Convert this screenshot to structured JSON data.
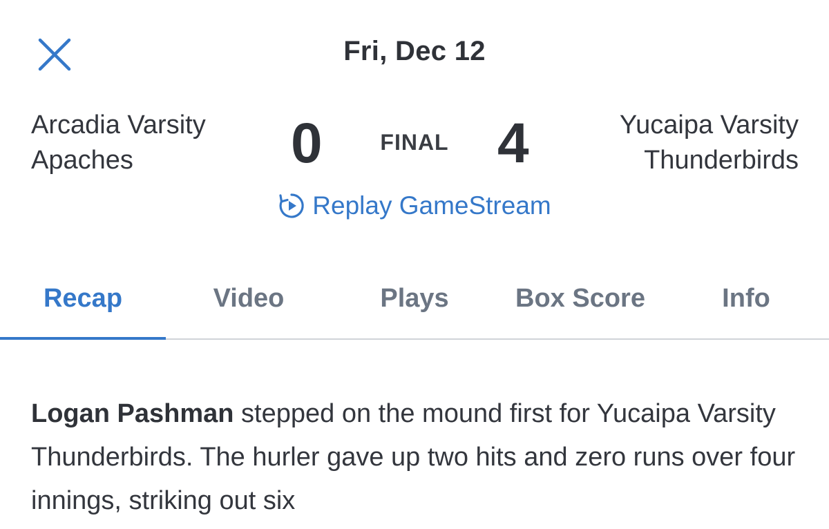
{
  "header": {
    "close_icon": "close-icon",
    "date": "Fri, Dec 12"
  },
  "game": {
    "home_team_line1": "Arcadia Varsity",
    "home_team_line2": "Apaches",
    "home_score": "0",
    "status": "FINAL",
    "away_score": "4",
    "away_team_line1": "Yucaipa Varsity",
    "away_team_line2": "Thunderbirds"
  },
  "replay": {
    "icon": "replay-icon",
    "label": "Replay GameStream"
  },
  "tabs": [
    {
      "label": "Recap",
      "active": true
    },
    {
      "label": "Video",
      "active": false
    },
    {
      "label": "Plays",
      "active": false
    },
    {
      "label": "Box Score",
      "active": false
    },
    {
      "label": "Info",
      "active": false
    }
  ],
  "recap": {
    "player_name": "Logan Pashman",
    "text": " stepped on the mound first for Yucaipa Varsity Thunderbirds. The hurler gave up two hits and zero runs over four innings, striking out six"
  },
  "colors": {
    "accent": "#3578c9",
    "text": "#33363d",
    "tab_inactive": "#6b7583",
    "divider": "#d0d3d8"
  }
}
